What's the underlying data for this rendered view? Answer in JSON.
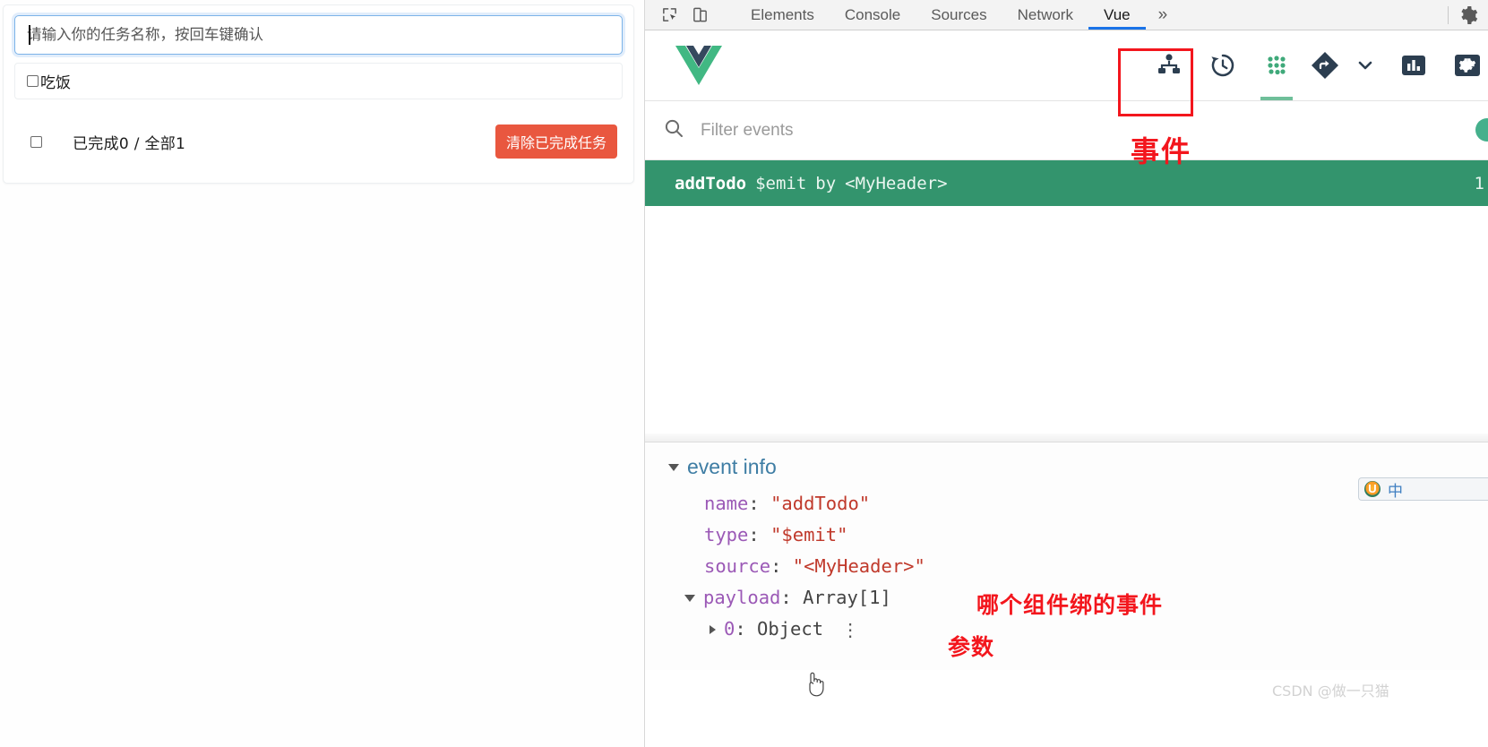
{
  "app": {
    "input": {
      "placeholder": "请输入你的任务名称，按回车键确认",
      "value": ""
    },
    "todos": [
      {
        "label": "吃饭",
        "done": false
      }
    ],
    "footer": {
      "count_text": "已完成0 / 全部1",
      "clear_label": "清除已完成任务",
      "all_checked": false
    }
  },
  "devtools": {
    "tabs": [
      {
        "label": "Elements",
        "active": false
      },
      {
        "label": "Console",
        "active": false
      },
      {
        "label": "Sources",
        "active": false
      },
      {
        "label": "Network",
        "active": false
      },
      {
        "label": "Vue",
        "active": true
      }
    ],
    "more_label": "»",
    "icons": {
      "inspect": "inspect-element-icon",
      "device": "device-toolbar-icon",
      "settings": "gear-icon"
    }
  },
  "vue_toolbar": {
    "logo": "vue-logo",
    "actions": [
      {
        "name": "components-tree-icon",
        "selected": false
      },
      {
        "name": "timeline-history-icon",
        "selected": false
      },
      {
        "name": "events-dots-icon",
        "selected": true
      },
      {
        "name": "routes-diamond-icon",
        "selected": false
      },
      {
        "name": "chevron-down-icon",
        "selected": false
      },
      {
        "name": "performance-bars-icon",
        "selected": false
      },
      {
        "name": "settings-gear-icon",
        "selected": false
      }
    ]
  },
  "filter": {
    "placeholder": "Filter events",
    "value": ""
  },
  "events": [
    {
      "name": "addTodo",
      "type": "$emit",
      "by": "by",
      "source": "<MyHeader>",
      "time": "1"
    }
  ],
  "event_info": {
    "title": "event info",
    "rows": [
      {
        "key": "name",
        "value": "\"addTodo\"",
        "kind": "string"
      },
      {
        "key": "type",
        "value": "\"$emit\"",
        "kind": "string"
      },
      {
        "key": "source",
        "value": "\"<MyHeader>\"",
        "kind": "string"
      }
    ],
    "payload": {
      "key": "payload",
      "value": "Array[1]",
      "child_index": "0",
      "child_value": "Object",
      "menu": "⋮"
    }
  },
  "annotations": [
    {
      "id": "events",
      "text": "事件"
    },
    {
      "id": "source",
      "text": "哪个组件绑的事件"
    },
    {
      "id": "payload",
      "text": "参数"
    }
  ],
  "ime": {
    "logo": "sogou-input-icon",
    "mode": "中"
  },
  "watermark": {
    "text": "CSDN @做一只猫"
  },
  "colors": {
    "event_row_green": "#33946d",
    "annotation_red": "#f3161d",
    "clear_button_red": "#e9573f",
    "vue_green": "#41b883",
    "devtools_tab_blue": "#1a73e8"
  }
}
